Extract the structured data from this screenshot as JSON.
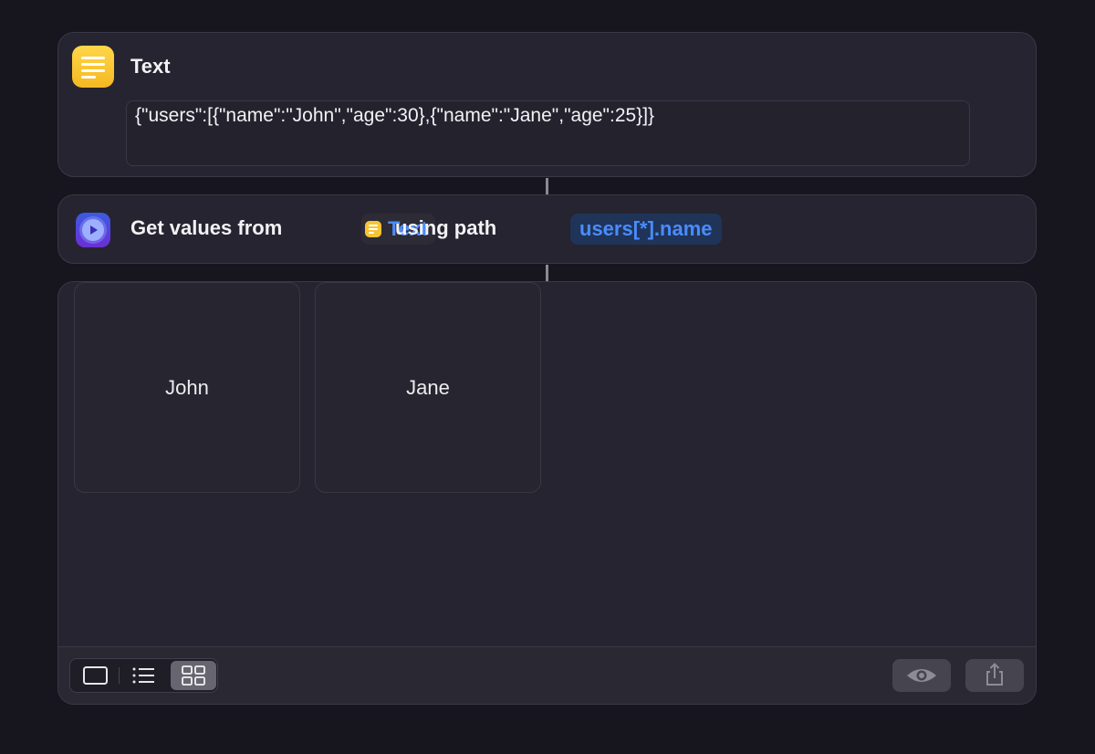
{
  "text_action": {
    "title": "Text",
    "icon": "text-lines-icon",
    "value": "{\"users\":[{\"name\":\"John\",\"age\":30},{\"name\":\"Jane\",\"age\":25}]}"
  },
  "get_values_action": {
    "icon": "script-gear-icon",
    "label_before": "Get values from",
    "variable_label": "Text",
    "label_middle": "using path",
    "path_value": "users[*].name"
  },
  "result": {
    "items": [
      "John",
      "Jane"
    ],
    "view_modes": [
      "single-view-icon",
      "list-view-icon",
      "grid-view-icon"
    ],
    "selected_view": "grid-view-icon",
    "actions": [
      "quick-look-icon",
      "share-icon"
    ]
  },
  "colors": {
    "background": "#17151e",
    "card": "#262430",
    "accent_blue": "#4a8cff",
    "text_icon_yellow": "#f7c533",
    "path_token_bg": "#1f3458"
  }
}
